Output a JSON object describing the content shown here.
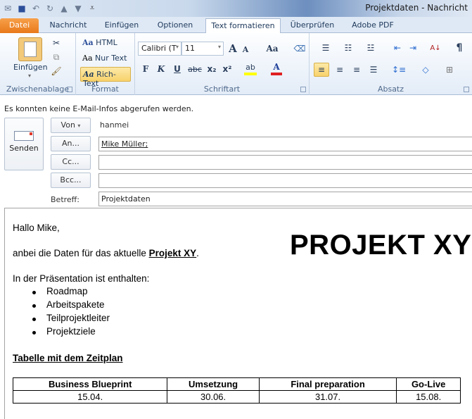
{
  "window": {
    "title": "Projektdaten - Nachricht"
  },
  "quick_access": [
    "outlook-icon",
    "save-icon",
    "undo-icon",
    "redo-icon",
    "up-icon",
    "down-icon",
    "customize-icon"
  ],
  "tabs": [
    {
      "label": "Datei"
    },
    {
      "label": "Nachricht"
    },
    {
      "label": "Einfügen"
    },
    {
      "label": "Optionen"
    },
    {
      "label": "Text formatieren",
      "active": true
    },
    {
      "label": "Überprüfen"
    },
    {
      "label": "Adobe PDF"
    }
  ],
  "ribbon": {
    "clipboard": {
      "label": "Zwischenablage",
      "paste": "Einfügen"
    },
    "format": {
      "label": "Format",
      "html": "HTML",
      "plain": "Nur Text",
      "rich": "Rich-Text",
      "aa": "Aa"
    },
    "font": {
      "label": "Schriftart",
      "font_name": "Calibri (T",
      "font_size": "11",
      "bold": "F",
      "italic": "K",
      "underline": "U",
      "strike": "abc",
      "sub": "x₂",
      "sup": "x²",
      "grow": "A",
      "shrink": "A",
      "case": "Aa",
      "highlight": "ab",
      "color": "A"
    },
    "paragraph": {
      "label": "Absatz",
      "pilcrow": "¶"
    }
  },
  "info_bar": "Es konnten keine E-Mail-Infos abgerufen werden.",
  "header": {
    "send": "Senden",
    "from_button": "Von",
    "from_value": "hanmei",
    "to_button": "An...",
    "to_value": "Mike Müller;",
    "cc_button": "Cc...",
    "cc_value": "",
    "bcc_button": "Bcc...",
    "bcc_value": "",
    "subject_label": "Betreff:",
    "subject_value": "Projektdaten"
  },
  "body": {
    "greeting": "Hallo Mike,",
    "intro_prefix": "anbei die Daten für das aktuelle ",
    "intro_link": "Projekt XY",
    "intro_suffix": ".",
    "big_title": "PROJEKT XY",
    "contains": "In der Präsentation ist enthalten:",
    "items": [
      "Roadmap",
      "Arbeitspakete",
      "Teilprojektleiter",
      "Projektziele"
    ],
    "table_heading": "Tabelle mit dem Zeitplan",
    "table": {
      "headers": [
        "Business Blueprint",
        "Umsetzung",
        "Final preparation",
        "Go-Live"
      ],
      "rows": [
        [
          "15.04.",
          "30.06.",
          "31.07.",
          "15.08."
        ]
      ]
    }
  }
}
